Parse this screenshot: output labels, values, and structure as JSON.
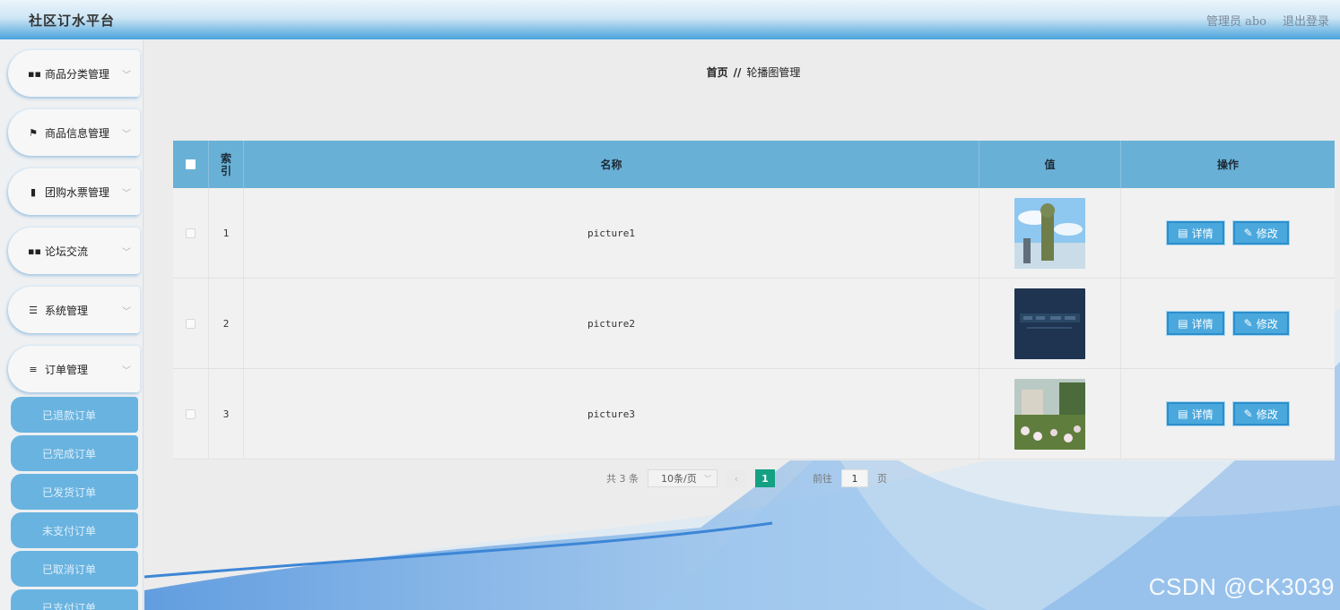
{
  "app": {
    "title": "社区订水平台",
    "admin_label": "管理员 abo",
    "logout_label": "退出登录"
  },
  "sidebar": {
    "menus": [
      {
        "label": "商品分类管理",
        "icon": "grid-icon"
      },
      {
        "label": "商品信息管理",
        "icon": "flag-icon"
      },
      {
        "label": "团购水票管理",
        "icon": "trash-icon"
      },
      {
        "label": "论坛交流",
        "icon": "grid-icon"
      },
      {
        "label": "系统管理",
        "icon": "sliders-icon"
      },
      {
        "label": "订单管理",
        "icon": "list-icon"
      }
    ],
    "sub_items": [
      {
        "label": "已退款订单"
      },
      {
        "label": "已完成订单"
      },
      {
        "label": "已发货订单"
      },
      {
        "label": "未支付订单"
      },
      {
        "label": "已取消订单"
      },
      {
        "label": "已支付订单"
      }
    ]
  },
  "breadcrumb": {
    "home": "首页",
    "separator": "//",
    "current": "轮播图管理"
  },
  "table": {
    "headers": {
      "index": "索引",
      "name": "名称",
      "value": "值",
      "actions": "操作"
    },
    "rows": [
      {
        "index": "1",
        "name": "picture1",
        "thumb": "statue-photo"
      },
      {
        "index": "2",
        "name": "picture2",
        "thumb": "dark-sign-photo"
      },
      {
        "index": "3",
        "name": "picture3",
        "thumb": "garden-photo"
      }
    ],
    "detail_label": "详情",
    "edit_label": "修改"
  },
  "pagination": {
    "total_text": "共 3 条",
    "page_size": "10条/页",
    "current_page": "1",
    "goto_label": "前往",
    "goto_value": "1",
    "page_suffix": "页"
  },
  "watermark": "CSDN @CK3039",
  "colors": {
    "accent": "#69b0d6",
    "button": "#4aa8dd",
    "pager_active": "#14a083"
  }
}
